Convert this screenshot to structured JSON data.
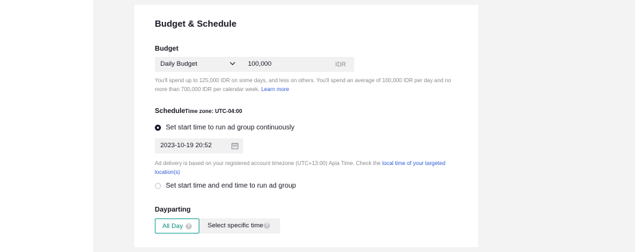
{
  "section": {
    "title": "Budget & Schedule"
  },
  "budget": {
    "label": "Budget",
    "type_selected": "Daily Budget",
    "amount_value": "100,000",
    "currency": "IDR",
    "hint": "You'll spend up to 125,000 IDR on some days, and less on others. You'll spend an average of 100,000 IDR per day and no more than 700,000 IDR per calendar week.",
    "hint_link": "Learn more"
  },
  "schedule": {
    "label": "Schedule",
    "timezone": "Time zone: UTC-04:00",
    "option_continuous": "Set start time to run ad group continuously",
    "start_datetime": "2023-10-19 20:52",
    "delivery_hint": "Ad delivery is based on your registered account timezone (UTC+13:00) Apia Time. Check the",
    "delivery_hint_link": "local time of your targeted location(s)",
    "option_start_end": "Set start time and end time to run ad group"
  },
  "dayparting": {
    "label": "Dayparting",
    "option_all_day": "All Day",
    "option_specific": "Select specific time",
    "help_glyph": "?"
  },
  "colors": {
    "accent": "#21a596",
    "link": "#2e5cd6",
    "muted": "#8a8b91",
    "field_bg": "#f1f1f2"
  }
}
